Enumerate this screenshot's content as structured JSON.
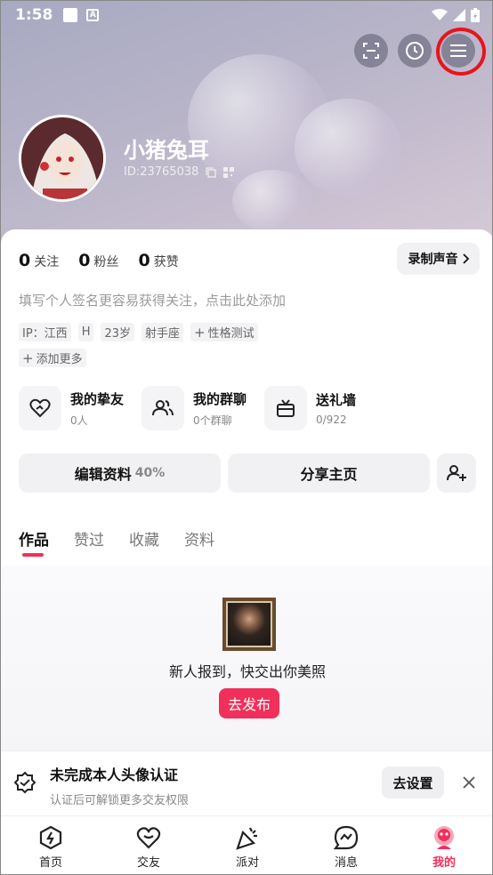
{
  "status_bar": {
    "time": "1:58"
  },
  "profile": {
    "name": "小猪兔耳",
    "id_text": "ID:23765038"
  },
  "stats": [
    {
      "num": "0",
      "label": "关注"
    },
    {
      "num": "0",
      "label": "粉丝"
    },
    {
      "num": "0",
      "label": "获赞"
    }
  ],
  "record_button": "录制声音",
  "bio_placeholder": "填写个人签名更容易获得关注，点击此处添加",
  "tags": [
    "IP：江西",
    "H",
    "23岁",
    "射手座",
    "性格测试"
  ],
  "add_more": "添加更多",
  "features": [
    {
      "title": "我的挚友",
      "sub": "0人",
      "icon": "heart-friends-icon"
    },
    {
      "title": "我的群聊",
      "sub": "0个群聊",
      "icon": "group-icon"
    },
    {
      "title": "送礼墙",
      "sub": "0/922",
      "icon": "gift-icon"
    }
  ],
  "buttons": {
    "edit_profile": "编辑资料",
    "edit_pct": "40%",
    "share": "分享主页"
  },
  "tabs": [
    "作品",
    "赞过",
    "收藏",
    "资料"
  ],
  "empty_state": {
    "text": "新人报到，快交出你美照",
    "publish": "去发布"
  },
  "verify": {
    "title": "未完成本人头像认证",
    "sub": "认证后可解锁更多交友权限",
    "button": "去设置"
  },
  "nav": [
    {
      "label": "首页",
      "icon": "home-icon"
    },
    {
      "label": "交友",
      "icon": "friends-icon"
    },
    {
      "label": "派对",
      "icon": "party-icon"
    },
    {
      "label": "消息",
      "icon": "message-icon"
    },
    {
      "label": "我的",
      "icon": "me-icon"
    }
  ],
  "colors": {
    "accent": "#f0305a",
    "highlight_ring": "#e8141c"
  }
}
